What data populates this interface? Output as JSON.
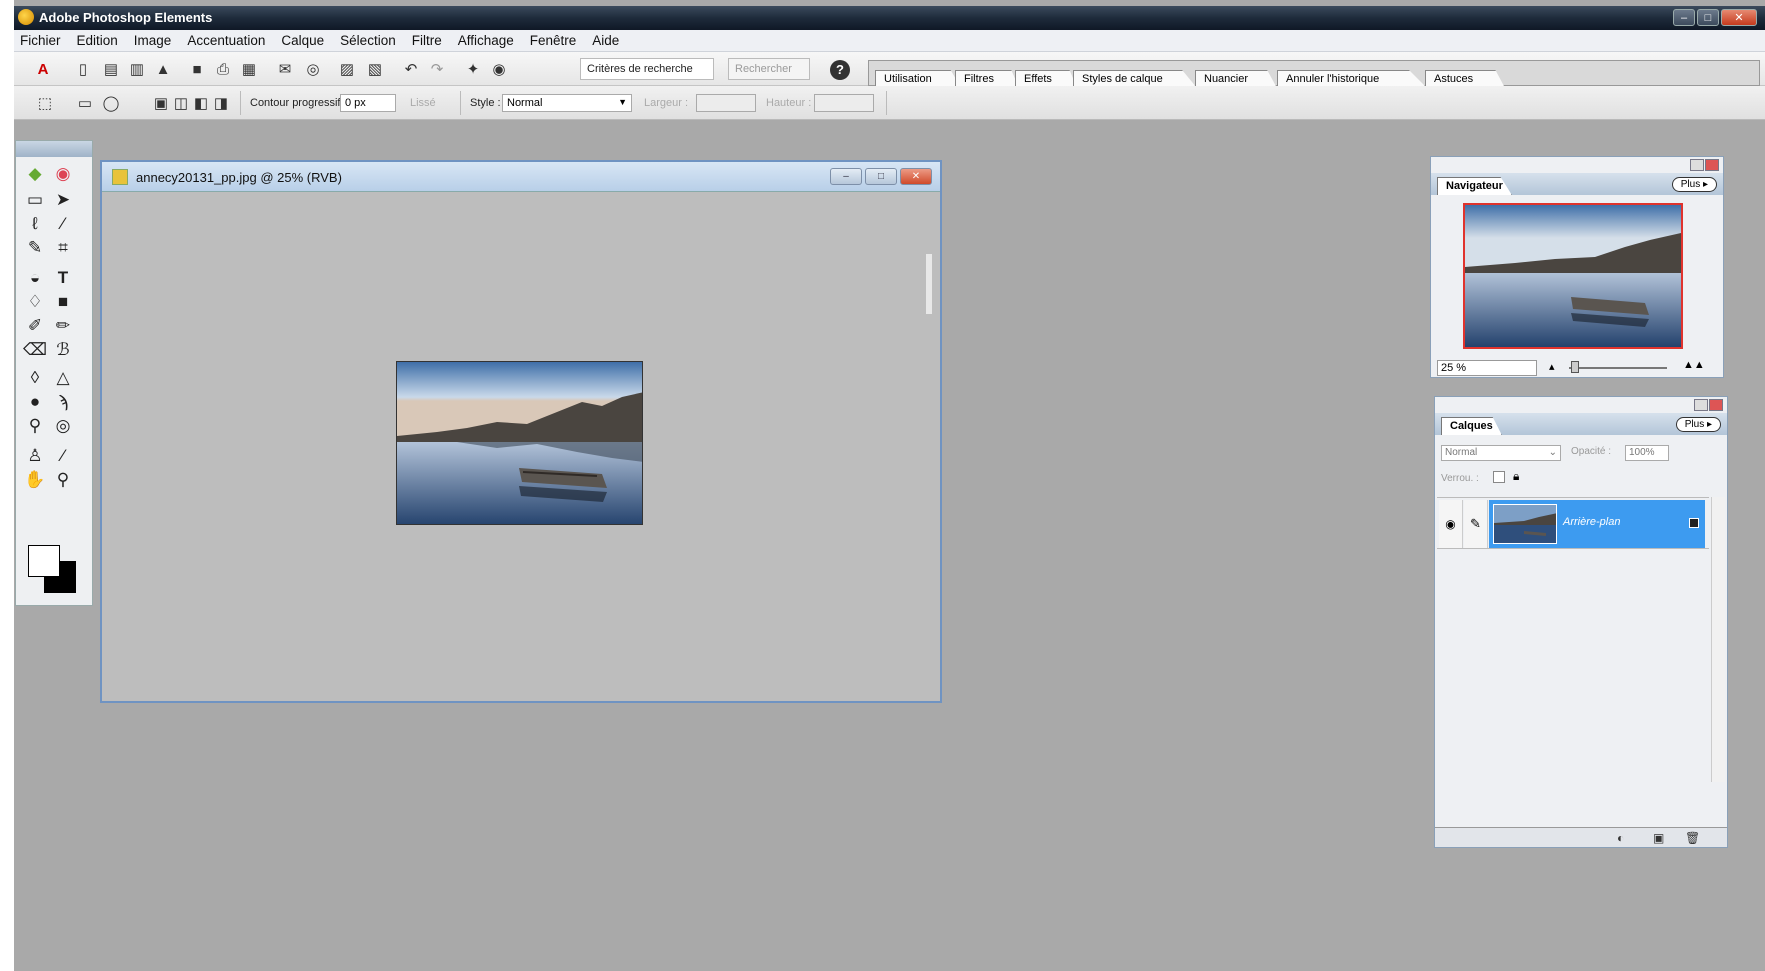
{
  "app": {
    "title": "Adobe Photoshop Elements"
  },
  "menu": [
    "Fichier",
    "Edition",
    "Image",
    "Accentuation",
    "Calque",
    "Sélection",
    "Filtre",
    "Affichage",
    "Fenêtre",
    "Aide"
  ],
  "toolbar": {
    "search_field": "Critères de recherche",
    "search_button": "Rechercher"
  },
  "palette_tabs": [
    "Utilisation",
    "Filtres",
    "Effets",
    "Styles de calque",
    "Nuancier",
    "Annuler l'historique",
    "Astuces"
  ],
  "options": {
    "feather_label": "Contour progressif :",
    "feather_value": "0 px",
    "antialias_label": "Lissé",
    "style_label": "Style :",
    "style_value": "Normal",
    "width_label": "Largeur :",
    "height_label": "Hauteur :"
  },
  "document": {
    "title": "annecy20131_pp.jpg @ 25% (RVB)"
  },
  "navigator": {
    "tab": "Navigateur",
    "more": "Plus",
    "zoom": "25 %"
  },
  "layers": {
    "tab": "Calques",
    "more": "Plus",
    "blend_mode": "Normal",
    "opacity_label": "Opacité :",
    "opacity_value": "100%",
    "lock_label": "Verrou. :",
    "layer_name": "Arrière-plan"
  },
  "colors": {
    "selection": "#3d9bf0",
    "workspace": "#a9a9a9",
    "doc_border": "#6f93c2"
  }
}
